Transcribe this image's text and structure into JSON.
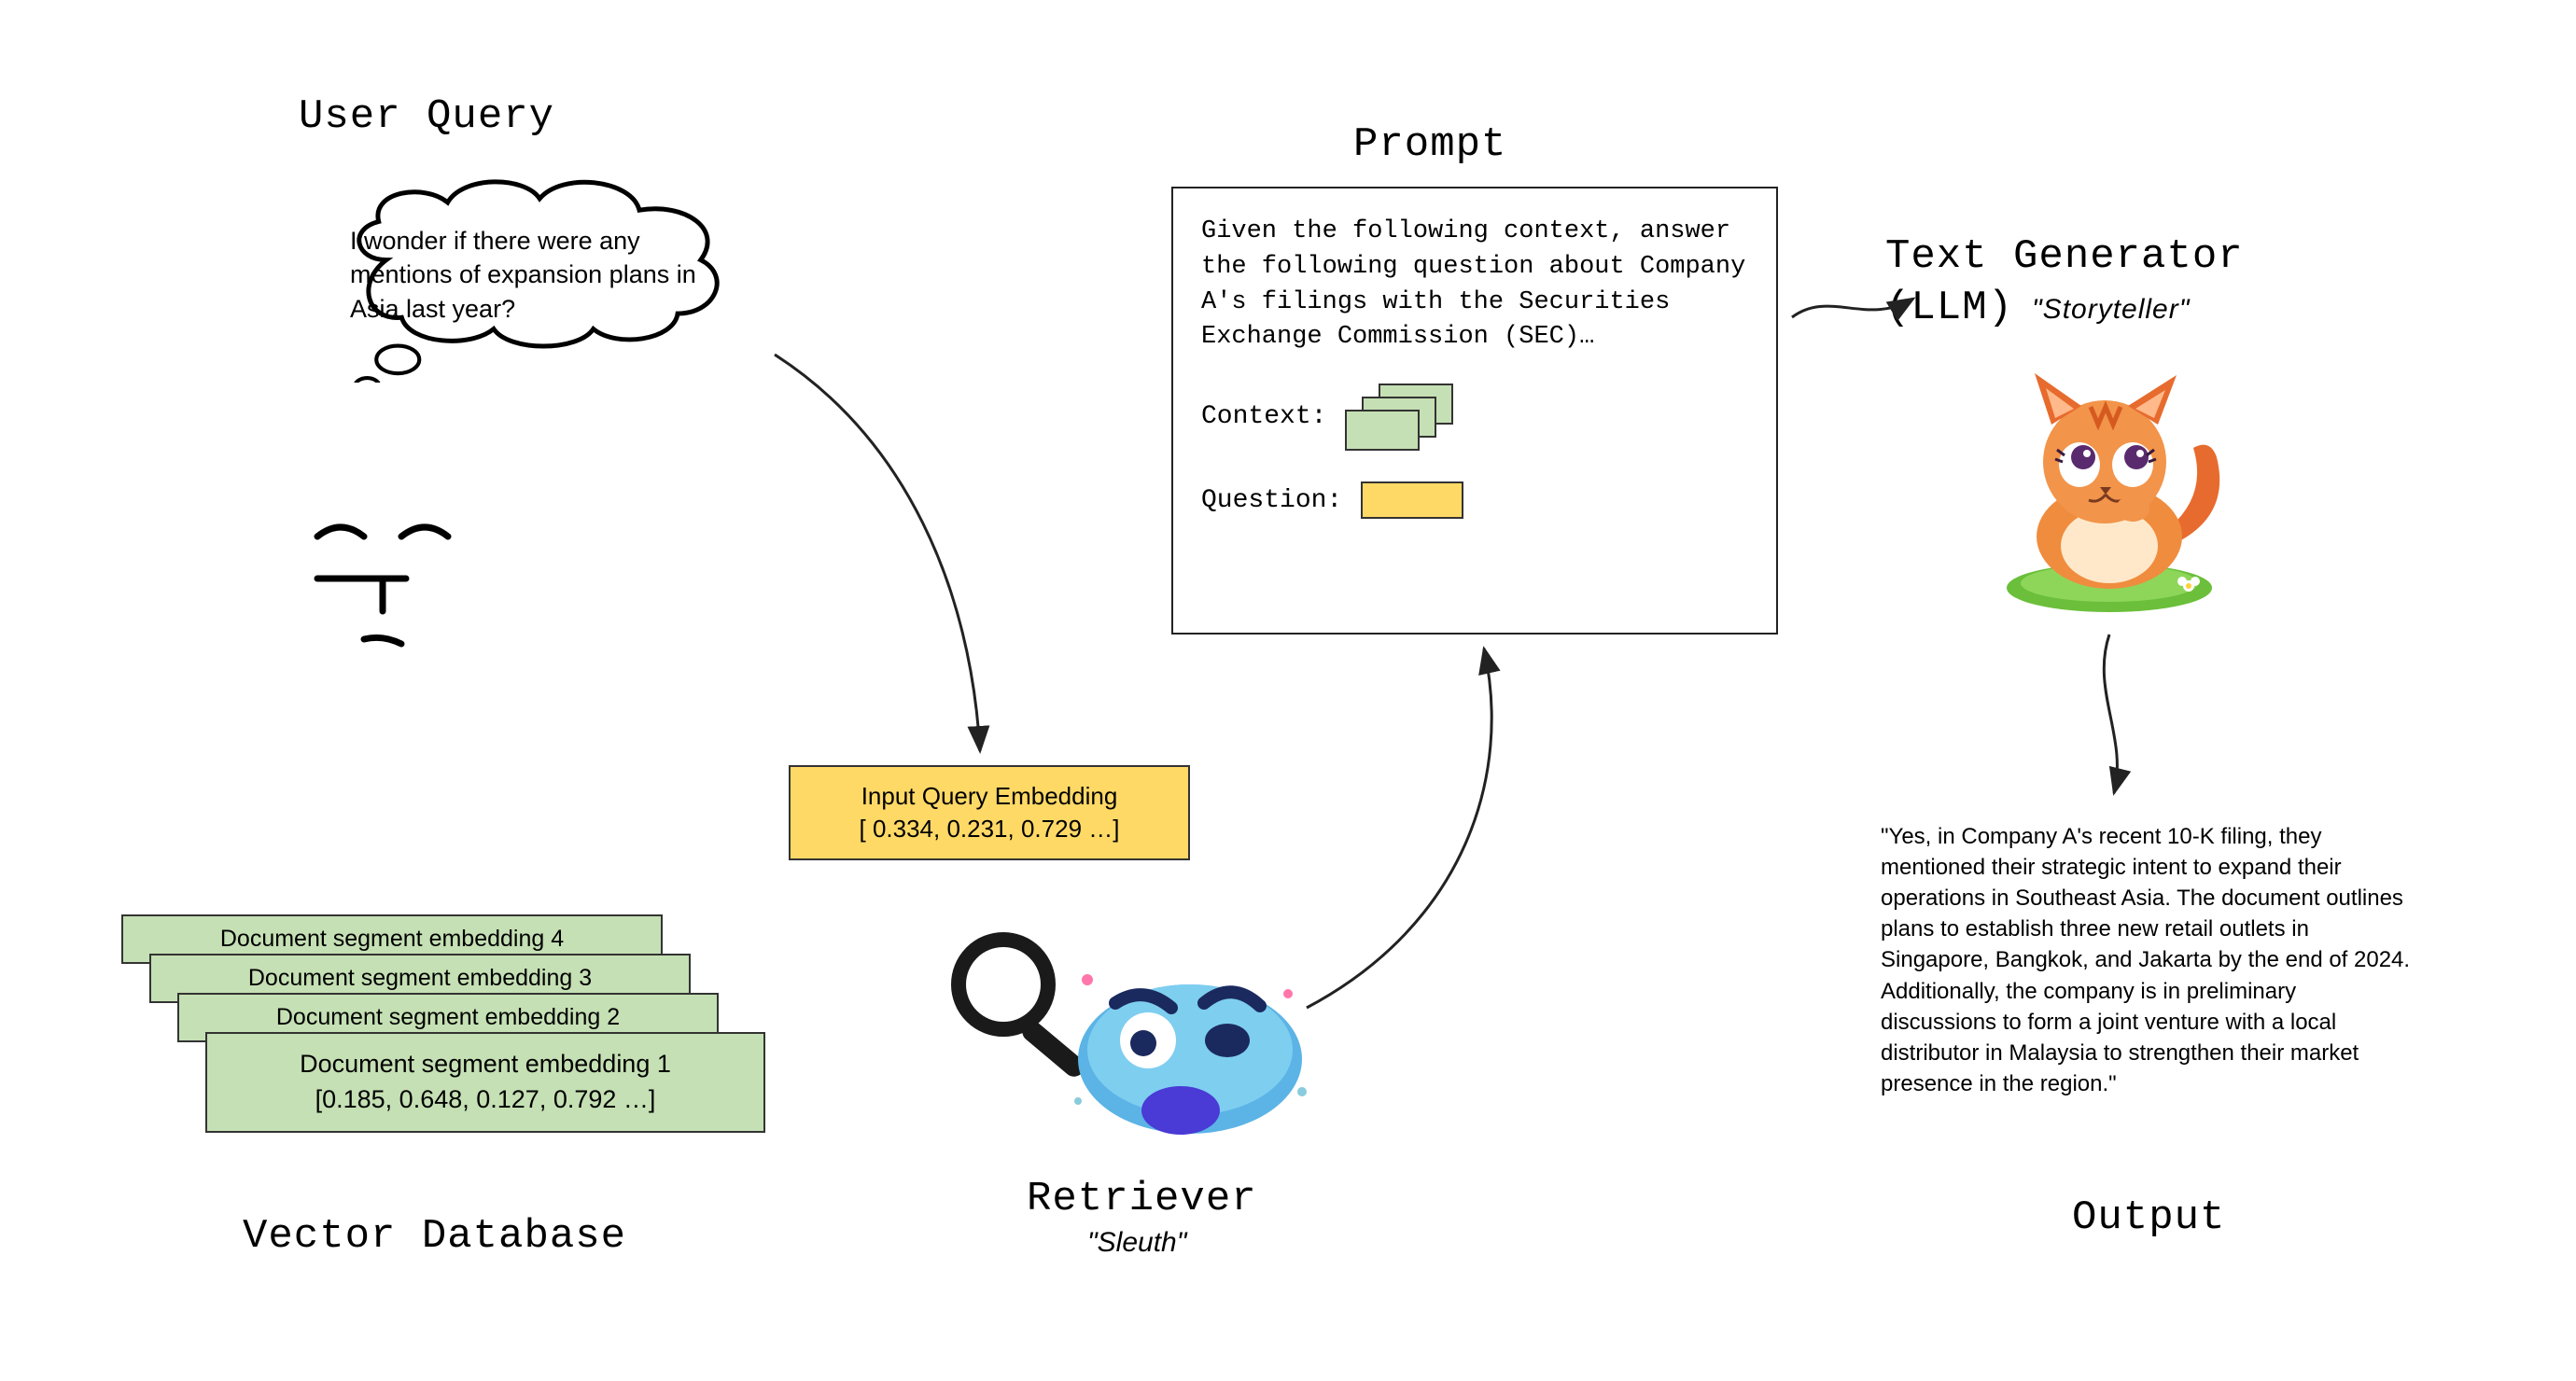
{
  "headings": {
    "user_query": "User Query",
    "prompt": "Prompt",
    "llm_line1": "Text Generator",
    "llm_line2": "(LLM)",
    "llm_sub": "\"Storyteller\"",
    "vector_db": "Vector Database",
    "retriever": "Retriever",
    "retriever_sub": "\"Sleuth\"",
    "output": "Output"
  },
  "thought": {
    "text": "I wonder if there were any mentions of expansion plans in Asia last year?"
  },
  "query_embedding": {
    "line1": "Input Query Embedding",
    "line2": "[ 0.334, 0.231, 0.729 …]"
  },
  "docs": {
    "card4": "Document segment embedding 4",
    "card3": "Document segment embedding 3",
    "card2": "Document segment embedding 2",
    "card1_line1": "Document segment embedding 1",
    "card1_line2": "[0.185, 0.648, 0.127, 0.792 …]"
  },
  "prompt_box": {
    "body": "Given the following context, answer the following question about Company A's filings with the Securities Exchange Commission (SEC)…",
    "context_label": "Context:",
    "question_label": "Question:"
  },
  "output_text": "\"Yes, in Company A's recent 10-K filing, they mentioned their strategic intent to expand their operations in Southeast Asia. The document outlines plans to establish three new retail outlets in Singapore, Bangkok, and Jakarta by the end of 2024. Additionally, the company is in preliminary discussions to form a joint venture with a local distributor in Malaysia to strengthen their market presence in the region.\""
}
